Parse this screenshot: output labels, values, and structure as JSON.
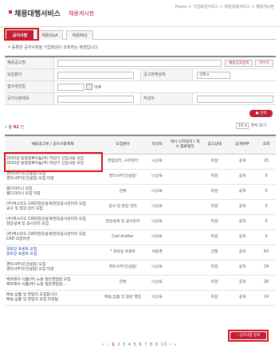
{
  "header": {
    "title": "채용대행서비스",
    "subtitle": "채용게시판",
    "breadcrumb": "Home  >  기업회원서비스  >  채용대행서비스  >  채용게시판"
  },
  "tabs": [
    {
      "label": "공지사항"
    },
    {
      "label": "채용Q&A"
    },
    {
      "label": "채용FAQ"
    }
  ],
  "notice": {
    "text": "등록한 공지사항을 기업회원이 조회하는 화면입니다."
  },
  "form": {
    "company_label": "채용공고명",
    "company_btn1": "채용공고검색",
    "company_btn2": "지우기",
    "field_label": "모집분야",
    "status_label": "공고현재상태",
    "status_value": "선택",
    "date_label": "접수마감일",
    "date_after": "이후",
    "title_label": "공지사항제목",
    "author_label": "작성자"
  },
  "search_btn": "검색",
  "list": {
    "count_prefix": "총",
    "count": "92",
    "count_suffix": "건",
    "perpage_value": "10",
    "perpage_suffix": "개씩 보기"
  },
  "table": {
    "headers": [
      "채용공고명 / 공지사항제목",
      "모집분야",
      "작성자",
      "게시 시작일자 / 게시 종료일자",
      "공고상태",
      "공개여부",
      "조회"
    ],
    "rows": [
      {
        "title1": "2010년 동일알루미늄(주) 하반기 신입사원 모집",
        "title2": "2010년 동일알루미늄(주) 하반기 신입사원 모집",
        "field": "영업관리, 사무관리",
        "author": "나상숙",
        "status": "마감",
        "open": "공개",
        "views": "15"
      },
      {
        "title1": "경리사무직(건설업) 모집",
        "title2": "경리사무직(건설업) 모집 마감",
        "field": "경리사무(건설업)",
        "author": "나상숙",
        "status": "마감",
        "open": "공개",
        "views": "0"
      },
      {
        "title1": "웹디자이너 모집",
        "title2": "웹디자이너 모집 마감",
        "field": "전체",
        "author": "나상숙",
        "status": "마감",
        "open": "공개",
        "views": "0"
      },
      {
        "title1": "(주)케스티드 CAD/현장설계/현장공사관리자 모집",
        "title2": "공사 및 현장 관리 모집",
        "field": "공사 및 현장 관리",
        "author": "나상숙",
        "status": "마감",
        "open": "공개",
        "views": "0"
      },
      {
        "title1": "(주)케스티드 CAD/현장설계/현장공사관리자 모집",
        "title2": "현장설계 및 공사관리 모집",
        "field": "현장설계 및 공사관리",
        "author": "나상숙",
        "status": "마감",
        "open": "공개",
        "views": "0"
      },
      {
        "title1": "(주)케스티드 CAD/현장설계/현장공사관리자 모집",
        "title2": "CAD 모집마감",
        "field": "Cad drafter",
        "author": "나상숙",
        "status": "마감",
        "open": "공개",
        "views": "0"
      },
      {
        "title1": "골프장 프론트 모집",
        "title2": "골프장 프론트 모집",
        "field": "* 골프장 프론트",
        "author": "서윤경",
        "status": "진행",
        "open": "공개",
        "views": "63"
      },
      {
        "title1": "경리사무직(건설업) 모집",
        "title2": "경리사무직(건설업) 모집 마감",
        "field": "경리사무(건설업)",
        "author": "나상숙",
        "status": "마감",
        "open": "공개",
        "views": "24"
      },
      {
        "title1": "백마레이-식품(주) 노동 일반영업원 모집",
        "title2": "백마레이-식품(주) 노동 일반영업원...",
        "field": "전체",
        "author": "나상숙",
        "status": "마감",
        "open": "공개",
        "views": "28"
      },
      {
        "title1": "배송,납품 및 영업직 모집합니다.",
        "title2": "배송,납품 및 영업직 모집 마감됨",
        "field": "배송,납품 및 일반 영업",
        "author": "나상숙",
        "status": "마감",
        "open": "공개",
        "views": "24"
      }
    ]
  },
  "register_btn": "공지사항 등록",
  "pager": {
    "prev": "« ‹",
    "pages": [
      "1",
      "2",
      "3",
      "4",
      "5",
      "6",
      "7",
      "8",
      "9",
      "10"
    ],
    "next": "› »"
  },
  "colors": {
    "accent": "#c0203a",
    "highlight": "#e01010"
  }
}
